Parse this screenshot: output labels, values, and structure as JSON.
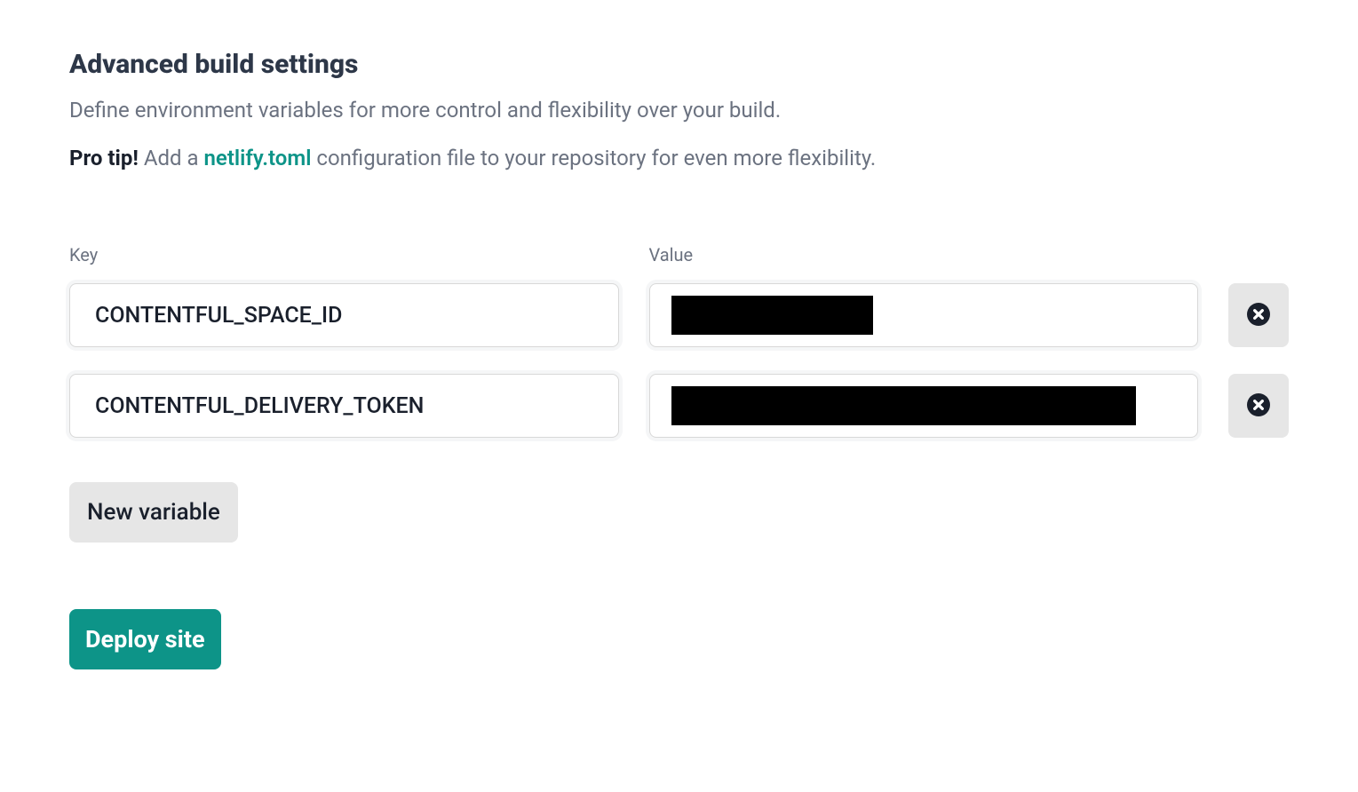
{
  "heading": "Advanced build settings",
  "description": "Define environment variables for more control and flexibility over your build.",
  "tip": {
    "label": "Pro tip!",
    "before_link": " Add a ",
    "link_text": "netlify.toml",
    "after_link": " configuration file to your repository for even more flexibility."
  },
  "columns": {
    "key": "Key",
    "value": "Value"
  },
  "variables": [
    {
      "key": "CONTENTFUL_SPACE_ID",
      "value": ""
    },
    {
      "key": "CONTENTFUL_DELIVERY_TOKEN",
      "value": ""
    }
  ],
  "buttons": {
    "new_variable": "New variable",
    "deploy_site": "Deploy site"
  }
}
